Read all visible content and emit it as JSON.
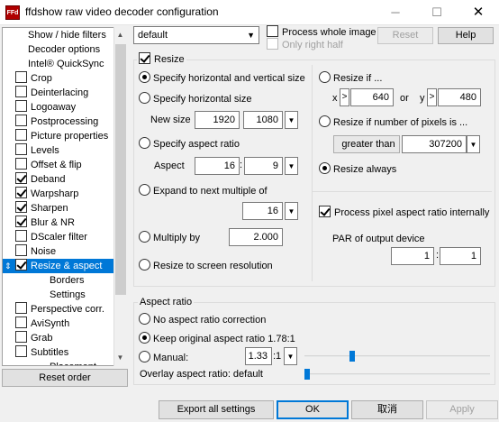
{
  "window": {
    "title": "ffdshow raw video decoder configuration",
    "app_icon": "ffdshow-app-icon",
    "minimize": "─",
    "maximize": "☐",
    "close": "✕"
  },
  "sidebar": {
    "items": [
      {
        "label": "Show / hide filters",
        "indent": 1,
        "checkbox": null
      },
      {
        "label": "Decoder options",
        "indent": 1,
        "checkbox": null
      },
      {
        "label": "Intel® QuickSync",
        "indent": 1,
        "checkbox": null
      },
      {
        "label": "Crop",
        "indent": 0,
        "checkbox": false
      },
      {
        "label": "Deinterlacing",
        "indent": 0,
        "checkbox": false
      },
      {
        "label": "Logoaway",
        "indent": 0,
        "checkbox": false
      },
      {
        "label": "Postprocessing",
        "indent": 0,
        "checkbox": false
      },
      {
        "label": "Picture properties",
        "indent": 0,
        "checkbox": false
      },
      {
        "label": "Levels",
        "indent": 0,
        "checkbox": false
      },
      {
        "label": "Offset & flip",
        "indent": 0,
        "checkbox": false
      },
      {
        "label": "Deband",
        "indent": 0,
        "checkbox": true
      },
      {
        "label": "Warpsharp",
        "indent": 0,
        "checkbox": true
      },
      {
        "label": "Sharpen",
        "indent": 0,
        "checkbox": true
      },
      {
        "label": "Blur & NR",
        "indent": 0,
        "checkbox": true
      },
      {
        "label": "DScaler filter",
        "indent": 0,
        "checkbox": false
      },
      {
        "label": "Noise",
        "indent": 0,
        "checkbox": false
      },
      {
        "label": "Resize & aspect",
        "indent": 0,
        "checkbox": true,
        "selected": true
      },
      {
        "label": "Borders",
        "indent": 2,
        "checkbox": null
      },
      {
        "label": "Settings",
        "indent": 2,
        "checkbox": null
      },
      {
        "label": "Perspective corr.",
        "indent": 0,
        "checkbox": false
      },
      {
        "label": "AviSynth",
        "indent": 0,
        "checkbox": false
      },
      {
        "label": "Grab",
        "indent": 0,
        "checkbox": false
      },
      {
        "label": "Subtitles",
        "indent": 0,
        "checkbox": false
      },
      {
        "label": "Placement",
        "indent": 2,
        "checkbox": null
      }
    ],
    "reset_order": "Reset order"
  },
  "top": {
    "preset": "default",
    "process_whole_image": "Process whole image",
    "only_right_half": "Only right half",
    "reset": "Reset",
    "help": "Help"
  },
  "resize": {
    "enabled_label": "Resize",
    "enabled": true,
    "spec_hv": "Specify horizontal and vertical size",
    "spec_h": "Specify horizontal size",
    "new_size_label": "New size",
    "new_w": "1920",
    "new_h": "1080",
    "spec_aspect": "Specify aspect ratio",
    "aspect_label": "Aspect",
    "aspect_a": "16",
    "aspect_sep": ":",
    "aspect_b": "9",
    "expand": "Expand to next multiple of",
    "expand_val": "16",
    "multiply": "Multiply by",
    "multiply_val": "2.000",
    "screen_res": "Resize to screen resolution",
    "resize_if": "Resize if ...",
    "x_label": "x",
    "x_op": ">",
    "x_val": "640",
    "or_label": "or",
    "y_label": "y",
    "y_op": ">",
    "y_val": "480",
    "resize_if_pixels": "Resize if number of pixels is ...",
    "pixel_cond": "greater than",
    "pixel_val": "307200",
    "resize_always": "Resize always",
    "process_par": "Process pixel aspect ratio internally",
    "par_label": "PAR of output device",
    "par_a": "1",
    "par_sep": ":",
    "par_b": "1"
  },
  "aspect": {
    "group_label": "Aspect ratio",
    "no_correction": "No aspect ratio correction",
    "keep_original": "Keep original aspect ratio 1.78:1",
    "manual": "Manual:",
    "manual_val": "1.33",
    "manual_suffix": ":1",
    "manual_slider_fraction": 0.2,
    "overlay": "Overlay aspect ratio: default",
    "overlay_slider_fraction": 0.0
  },
  "footer": {
    "export": "Export all settings",
    "ok": "OK",
    "cancel": "取消",
    "apply": "Apply"
  },
  "colors": {
    "selection": "#0078d7",
    "slider_thumb": "#0078d7"
  }
}
